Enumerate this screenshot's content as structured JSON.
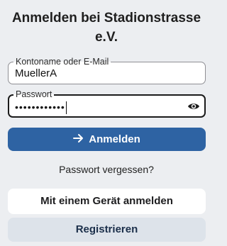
{
  "header": {
    "title": "Anmelden bei Stadionstrasse e.V."
  },
  "username": {
    "label": "Kontoname oder E-Mail",
    "value": "MuellerA"
  },
  "password": {
    "label": "Passwort",
    "masked_value": "••••••••••••"
  },
  "actions": {
    "login_label": "Anmelden",
    "forgot_password_label": "Passwort vergessen?",
    "device_login_label": "Mit einem Gerät anmelden",
    "register_label": "Registrieren"
  },
  "icons": {
    "eye": "eye-icon",
    "login_arrow": "arrow-right-icon"
  },
  "colors": {
    "primary": "#2e63a3",
    "background": "#eceef1",
    "secondary_button": "#dde3ea"
  }
}
